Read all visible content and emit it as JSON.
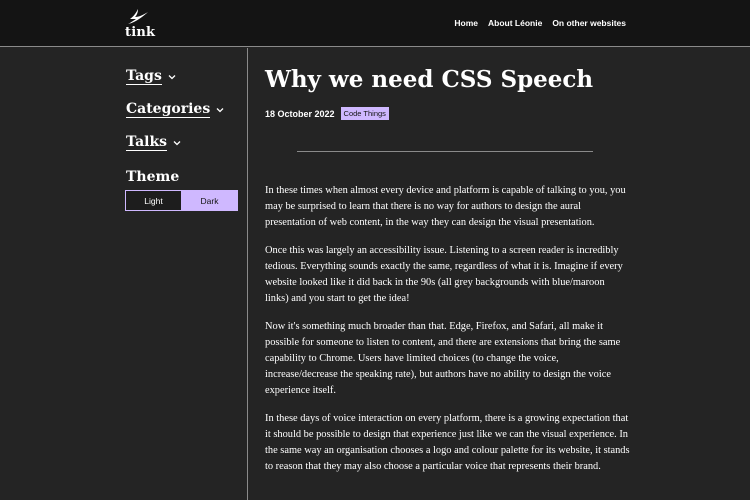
{
  "header": {
    "logo_text": "tink",
    "nav": [
      {
        "label": "Home"
      },
      {
        "label": "About Léonie"
      },
      {
        "label": "On other websites"
      }
    ]
  },
  "sidebar": {
    "sections": [
      {
        "label": "Tags"
      },
      {
        "label": "Categories"
      },
      {
        "label": "Talks"
      }
    ],
    "theme": {
      "title": "Theme",
      "light_label": "Light",
      "dark_label": "Dark",
      "selected": "Dark"
    }
  },
  "article": {
    "title": "Why we need CSS Speech",
    "date": "18 October 2022",
    "tag": "Code Things",
    "paragraphs": [
      "In these times when almost every device and platform is capable of talking to you, you may be surprised to learn that there is no way for authors to design the aural presentation of web content, in the way they can design the visual presentation.",
      "Once this was largely an accessibility issue. Listening to a screen reader is incredibly tedious. Everything sounds exactly the same, regardless of what it is. Imagine if every website looked like it did back in the 90s (all grey backgrounds with blue/maroon links) and you start to get the idea!",
      "Now it's something much broader than that. Edge, Firefox, and Safari, all make it possible for someone to listen to content, and there are extensions that bring the same capability to Chrome. Users have limited choices (to change the voice, increase/decrease the speaking rate), but authors have no ability to design the voice experience itself.",
      "In these days of voice interaction on every platform, there is a growing expectation that it should be possible to design that experience just like we can the visual experience. In the same way an organisation chooses a logo and colour palette for its website, it stands to reason that they may also choose a particular voice that represents their brand."
    ]
  },
  "colors": {
    "accent": "#cfb8ff",
    "background": "#242424",
    "header_background": "#141414"
  }
}
